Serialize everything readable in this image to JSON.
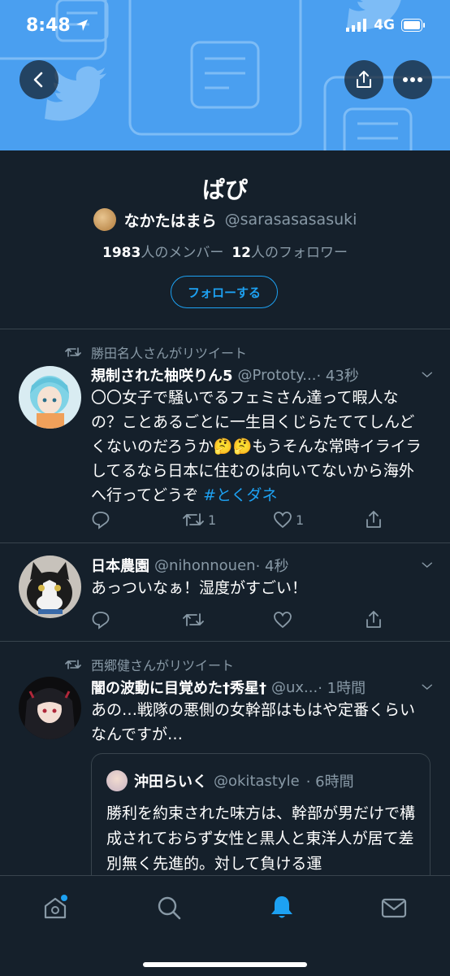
{
  "status_bar": {
    "time": "8:48",
    "network": "4G"
  },
  "list": {
    "title": "ぱぴ",
    "owner_name": "なかたはまら",
    "owner_handle": "@sarasasasasuki",
    "members_count": "1983",
    "members_label": "人のメンバー",
    "followers_count": "12",
    "followers_label": "人のフォロワー",
    "follow_button": "フォローする"
  },
  "tweets": [
    {
      "retweeted_by": "勝田名人さんがリツイート",
      "name": "規制された柚咲りん5",
      "handle": "@Prototy...",
      "time": "· 43秒",
      "body": "〇〇女子で騒いでるフェミさん達って暇人なの？ことあるごとに一生目くじらたててしんどくないのだろうか🤔🤔もうそんな常時イライラしてるなら日本に住むのは向いてないから海外へ行ってどうぞ ",
      "hashtag": "#とくダネ",
      "retweets": "1",
      "likes": "1"
    },
    {
      "name": "日本農園",
      "handle": "@nihonnouen",
      "time": "· 4秒",
      "body": "あっついなぁ！湿度がすごい！"
    },
    {
      "retweeted_by": "西郷健さんがリツイート",
      "name": "闇の波動に目覚めた†秀星†",
      "handle": "@ux...",
      "time": "· 1時間",
      "body": "あの…戦隊の悪側の女幹部はもはや定番くらいなんですが…",
      "quote": {
        "name": "沖田らいく",
        "handle": "@okitastyle",
        "time": "· 6時間",
        "body": "勝利を約束された味方は、幹部が男だけで構成されておらず女性と黒人と東洋人が居て差別無く先進的。対して負ける運"
      }
    }
  ],
  "colors": {
    "accent": "#1da1f2",
    "background": "#15202b",
    "banner": "#4a9ff0",
    "muted": "#8899a6"
  }
}
